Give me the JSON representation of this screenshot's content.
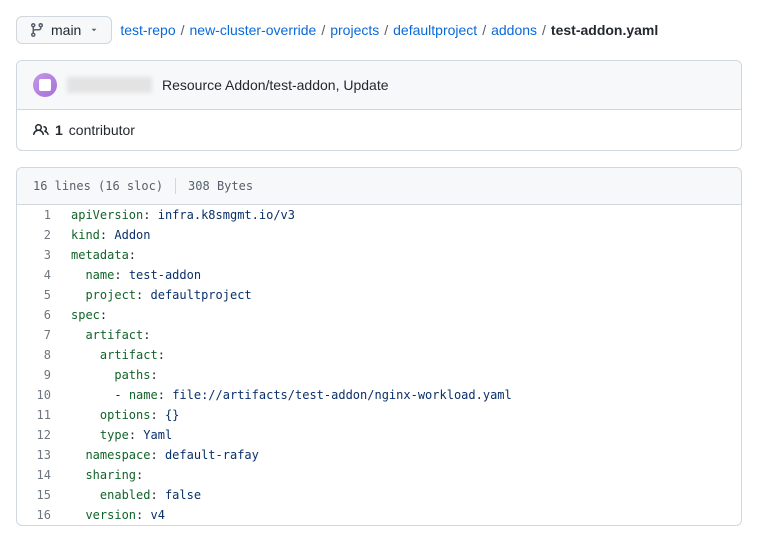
{
  "branch": {
    "name": "main"
  },
  "breadcrumbs": {
    "parts": [
      "test-repo",
      "new-cluster-override",
      "projects",
      "defaultproject",
      "addons"
    ],
    "current": "test-addon.yaml"
  },
  "commit": {
    "message": "Resource Addon/test-addon, Update"
  },
  "contributors": {
    "count": "1",
    "label": "contributor"
  },
  "file_meta": {
    "lines": "16 lines (16 sloc)",
    "size": "308 Bytes"
  },
  "chart_data": {
    "type": "table",
    "file_content": {
      "apiVersion": "infra.k8smgmt.io/v3",
      "kind": "Addon",
      "metadata": {
        "name": "test-addon",
        "project": "defaultproject"
      },
      "spec": {
        "artifact": {
          "artifact": {
            "paths": [
              {
                "name": "file://artifacts/test-addon/nginx-workload.yaml"
              }
            ]
          },
          "options": {},
          "type": "Yaml"
        },
        "namespace": "default-rafay",
        "sharing": {
          "enabled": false
        },
        "version": "v4"
      }
    }
  },
  "code_lines": [
    {
      "n": "1",
      "indent": 0,
      "key": "apiVersion",
      "val": "infra.k8smgmt.io/v3"
    },
    {
      "n": "2",
      "indent": 0,
      "key": "kind",
      "val": "Addon"
    },
    {
      "n": "3",
      "indent": 0,
      "key": "metadata",
      "val": ""
    },
    {
      "n": "4",
      "indent": 1,
      "key": "name",
      "val": "test-addon"
    },
    {
      "n": "5",
      "indent": 1,
      "key": "project",
      "val": "defaultproject"
    },
    {
      "n": "6",
      "indent": 0,
      "key": "spec",
      "val": ""
    },
    {
      "n": "7",
      "indent": 1,
      "key": "artifact",
      "val": ""
    },
    {
      "n": "8",
      "indent": 2,
      "key": "artifact",
      "val": ""
    },
    {
      "n": "9",
      "indent": 3,
      "key": "paths",
      "val": ""
    },
    {
      "n": "10",
      "indent": 3,
      "dash": true,
      "key": "name",
      "val": "file://artifacts/test-addon/nginx-workload.yaml"
    },
    {
      "n": "11",
      "indent": 2,
      "key": "options",
      "val": "{}"
    },
    {
      "n": "12",
      "indent": 2,
      "key": "type",
      "val": "Yaml"
    },
    {
      "n": "13",
      "indent": 1,
      "key": "namespace",
      "val": "default-rafay"
    },
    {
      "n": "14",
      "indent": 1,
      "key": "sharing",
      "val": ""
    },
    {
      "n": "15",
      "indent": 2,
      "key": "enabled",
      "val": "false"
    },
    {
      "n": "16",
      "indent": 1,
      "key": "version",
      "val": "v4"
    }
  ]
}
